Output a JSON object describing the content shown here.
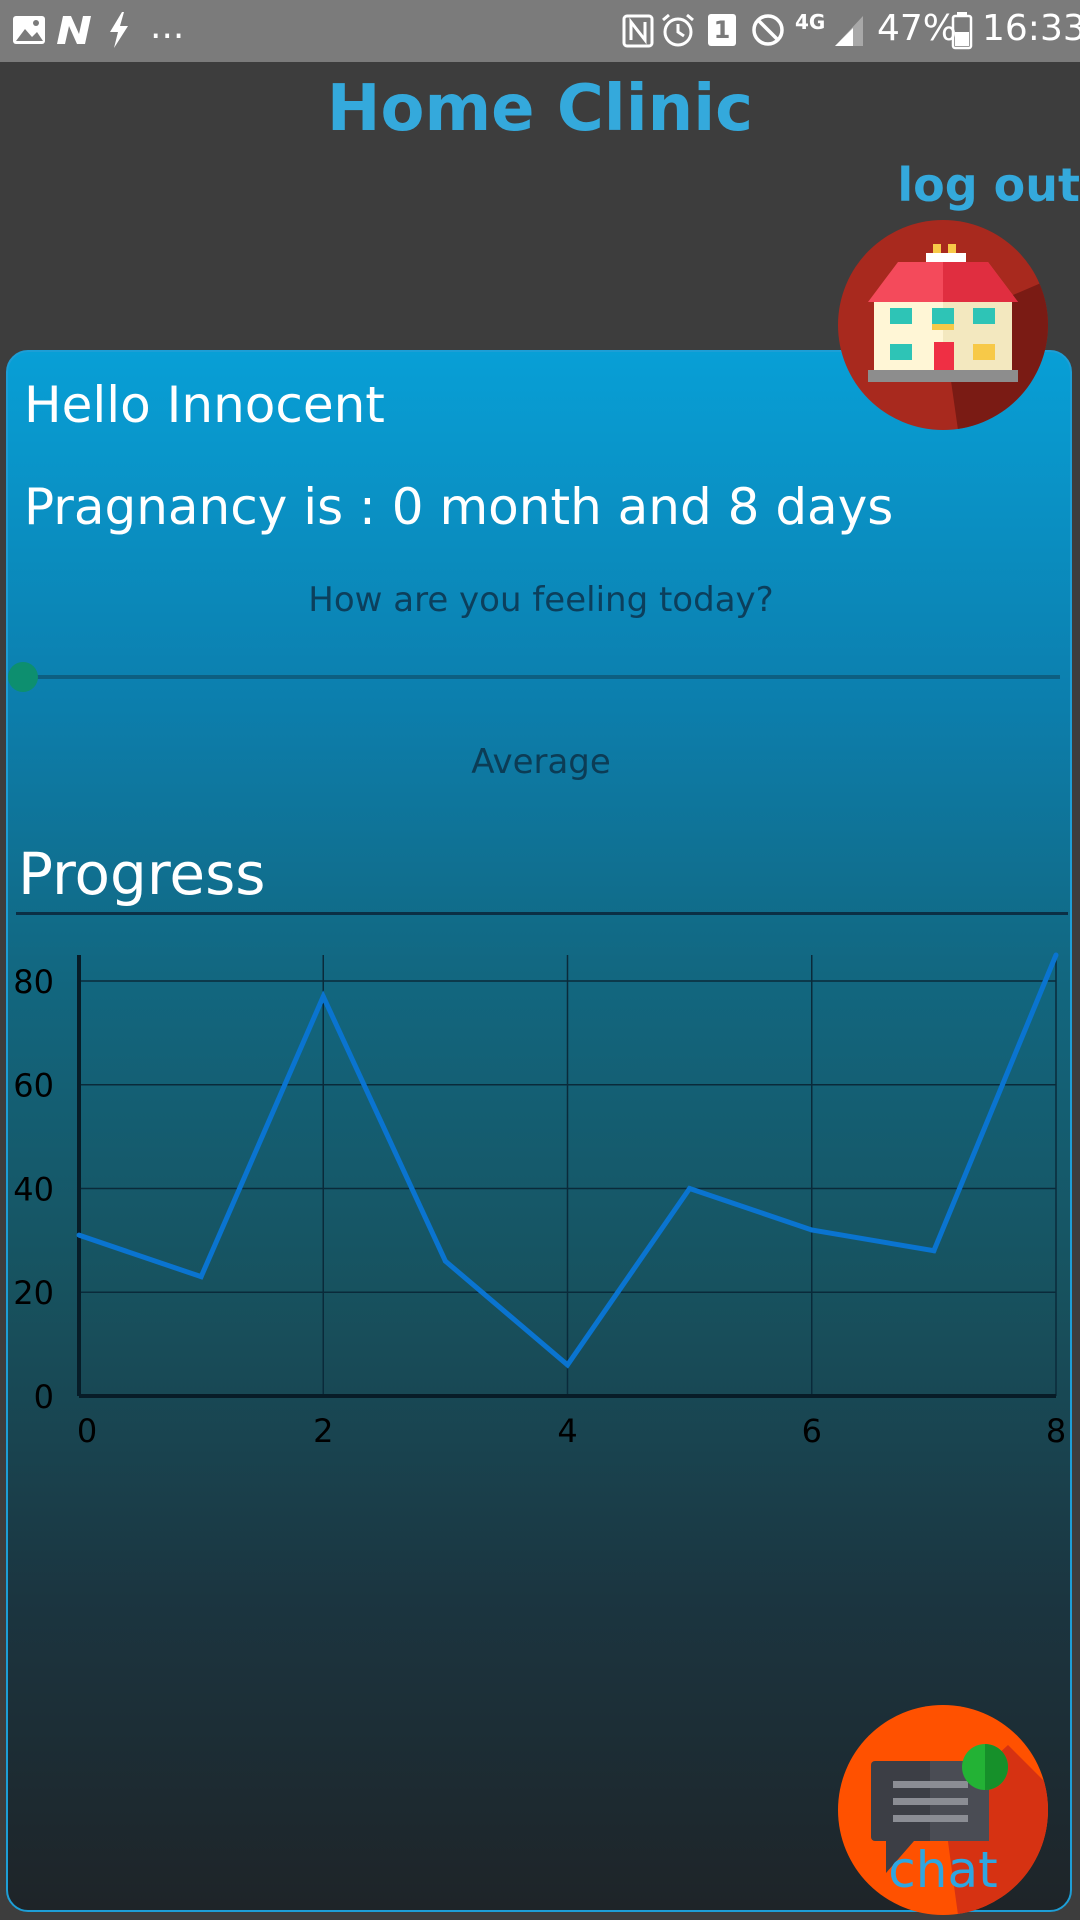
{
  "status_bar": {
    "notification_overflow": "...",
    "sim_slot": "1",
    "network": "4G",
    "battery": "47%",
    "time": "16:33",
    "icons": [
      "image-icon",
      "n-app-icon",
      "flash-icon",
      "nfc-icon",
      "alarm-icon",
      "sim-icon",
      "do-not-disturb-icon",
      "signal-icon",
      "battery-icon"
    ]
  },
  "header": {
    "title": "Home Clinic",
    "logout_label": "log out"
  },
  "greeting": "Hello Innocent",
  "pregnancy_text": "Pragnancy is : 0 month and 8 days",
  "feeling": {
    "question": "How are you feeling today?",
    "value_label": "Average",
    "slider_value": 0
  },
  "progress_title": "Progress",
  "chat_button": {
    "label": "chat",
    "icon": "chat-icon"
  },
  "home_button": {
    "icon": "house-icon"
  },
  "colors": {
    "accent": "#34a9dc",
    "line": "#0a74d0",
    "chat_bg": "#ff5100",
    "home_bg": "#a8291e"
  },
  "chart_data": {
    "type": "line",
    "x": [
      0,
      1,
      2,
      3,
      4,
      5,
      6,
      7,
      8
    ],
    "series": [
      {
        "values": [
          31,
          23,
          77,
          26,
          6,
          40,
          32,
          28,
          85
        ]
      }
    ],
    "xlim": [
      0,
      8
    ],
    "ylim": [
      0,
      85
    ],
    "xticks": [
      "0",
      "2",
      "4",
      "6",
      "8"
    ],
    "yticks": [
      "0",
      "20",
      "40",
      "60",
      "80"
    ],
    "grid": true,
    "title": "",
    "xlabel": "",
    "ylabel": ""
  }
}
